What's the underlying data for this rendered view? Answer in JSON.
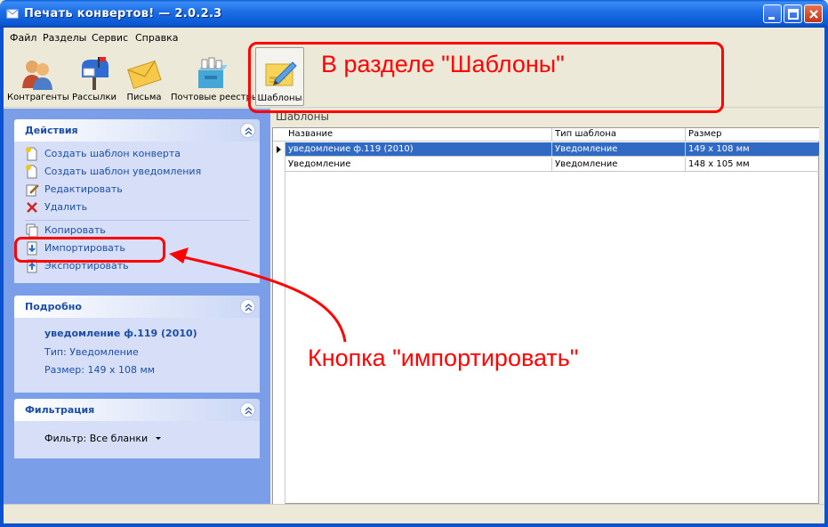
{
  "window": {
    "title": "Печать конвертов! — 2.0.2.3"
  },
  "menu": [
    "Файл",
    "Разделы",
    "Сервис",
    "Справка"
  ],
  "toolbar": [
    {
      "label": "Контрагенты",
      "icon": "contacts-icon"
    },
    {
      "label": "Рассылки",
      "icon": "mailbox-icon"
    },
    {
      "label": "Письма",
      "icon": "envelope-icon"
    },
    {
      "label": "Почтовые реестры",
      "icon": "registry-icon"
    },
    {
      "label": "Шаблоны",
      "icon": "template-icon",
      "active": true
    }
  ],
  "actions_panel": {
    "title": "Действия",
    "items": [
      {
        "label": "Создать шаблон конверта",
        "icon": "new-document-icon"
      },
      {
        "label": "Создать шаблон уведомления",
        "icon": "new-document-icon"
      },
      {
        "label": "Редактировать",
        "icon": "edit-icon"
      },
      {
        "label": "Удалить",
        "icon": "delete-icon"
      },
      {
        "label": "Копировать",
        "icon": "copy-icon"
      },
      {
        "label": "Импортировать",
        "icon": "import-icon"
      },
      {
        "label": "Экспортировать",
        "icon": "export-icon"
      }
    ]
  },
  "details_panel": {
    "title": "Подробно",
    "name": "уведомление ф.119 (2010)",
    "type_line": "Тип: Уведомление",
    "size_line": "Размер: 149 x 108 мм"
  },
  "filter_panel": {
    "title": "Фильтрация",
    "filter_label": "Фильтр: Все бланки"
  },
  "main": {
    "section_title": "Шаблоны",
    "columns": [
      "Название",
      "Тип шаблона",
      "Размер"
    ],
    "rows": [
      [
        "уведомление ф.119 (2010)",
        "Уведомление",
        "149 x 108 мм"
      ],
      [
        "Уведомление",
        "Уведомление",
        "148 x 105 мм"
      ]
    ],
    "selected_row": 0
  },
  "annotations": {
    "top": "В разделе \"Шаблоны\"",
    "middle": "Кнопка \"импортировать\"",
    "color": "#ff0000"
  },
  "colors": {
    "titlebar": "#0a58d2",
    "taskpane": "#7b9ee8",
    "panel_body": "#d6dff7",
    "link": "#1c4ea8",
    "selection": "#316ac5"
  }
}
